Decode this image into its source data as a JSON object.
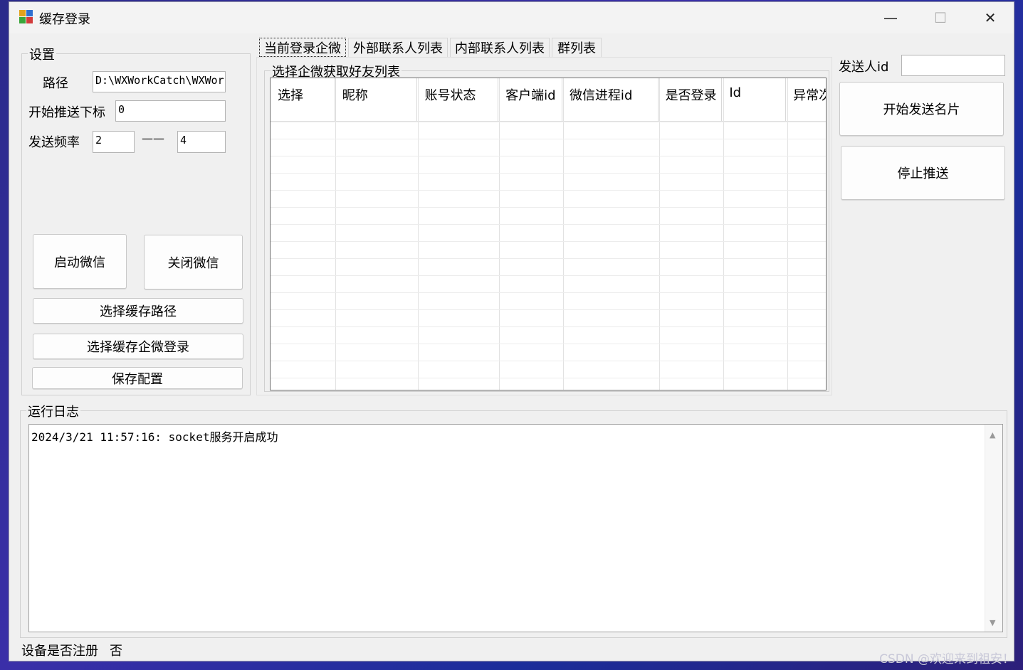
{
  "window": {
    "title": "缓存登录"
  },
  "settings": {
    "group_label": "设置",
    "path_label": "路径",
    "path_value": "D:\\WXWorkCatch\\WXWor",
    "start_index_label": "开始推送下标",
    "start_index_value": "0",
    "freq_label": "发送频率",
    "freq_min": "2",
    "freq_sep": "——",
    "freq_max": "4",
    "start_wechat": "启动微信",
    "close_wechat": "关闭微信",
    "choose_cache_path": "选择缓存路径",
    "choose_cache_login": "选择缓存企微登录",
    "save_config": "保存配置"
  },
  "tabs": [
    "当前登录企微",
    "外部联系人列表",
    "内部联系人列表",
    "群列表"
  ],
  "grid": {
    "group_label": "选择企微获取好友列表",
    "columns": [
      "选择",
      "昵称",
      "账号状态",
      "客户端id",
      "微信进程id",
      "是否登录",
      "Id",
      "异常次"
    ]
  },
  "sender": {
    "label": "发送人id",
    "value": "",
    "start_button": "开始发送名片",
    "stop_button": "停止推送"
  },
  "log": {
    "group_label": "运行日志",
    "lines": [
      "2024/3/21 11:57:16: socket服务开启成功"
    ]
  },
  "status": {
    "label": "设备是否注册",
    "value": "否"
  },
  "watermark": "CSDN @欢迎来到祖安！"
}
